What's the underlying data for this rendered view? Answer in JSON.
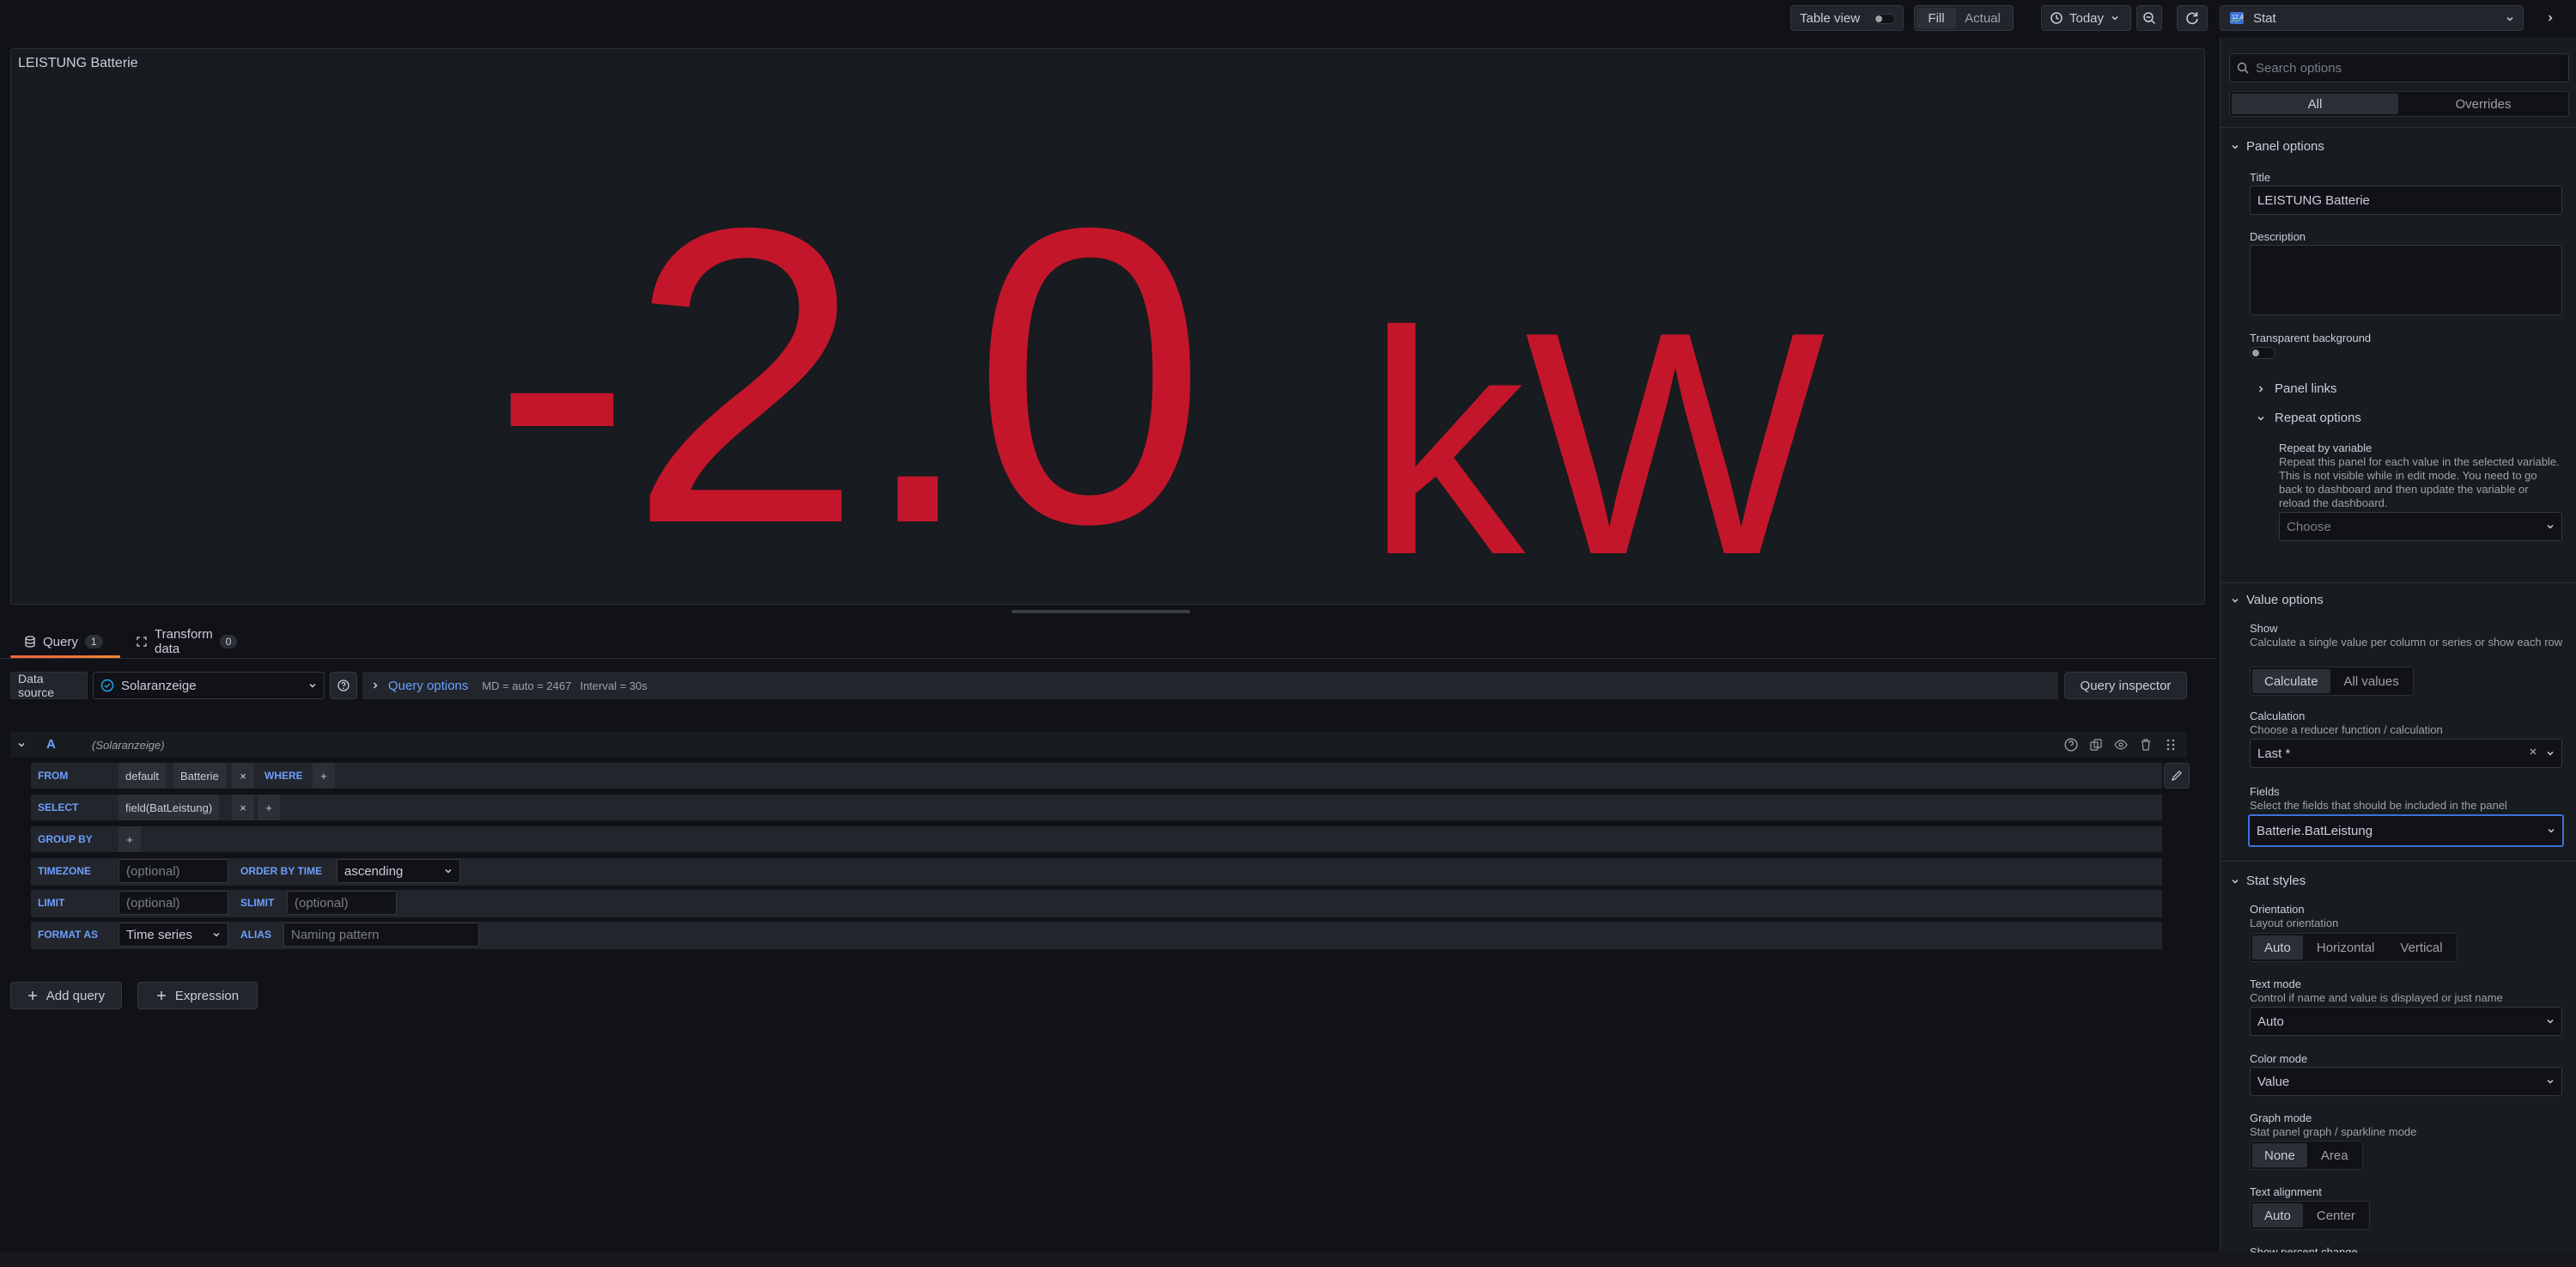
{
  "toolbar": {
    "table_view_label": "Table view",
    "fill_label": "Fill",
    "actual_label": "Actual",
    "time_range": "Today"
  },
  "viz_picker": {
    "label": "Stat"
  },
  "panel": {
    "title": "LEISTUNG Batterie",
    "value": "-2.0",
    "unit": "kW",
    "value_color": "#c4162a"
  },
  "query_tabs": [
    {
      "label": "Query",
      "count": "1"
    },
    {
      "label": "Transform data",
      "count": "0"
    }
  ],
  "datasource": {
    "label": "Data source",
    "value": "Solaranzeige",
    "query_options_label": "Query options",
    "md_info": "MD = auto = 2467",
    "interval_info": "Interval = 30s",
    "inspector_label": "Query inspector"
  },
  "query_a": {
    "ref": "A",
    "source": "(Solaranzeige)",
    "from_kw": "FROM",
    "from_policy": "default",
    "from_measurement": "Batterie",
    "where_kw": "WHERE",
    "select_kw": "SELECT",
    "select_field": "field(BatLeistung)",
    "groupby_kw": "GROUP BY",
    "timezone_kw": "TIMEZONE",
    "timezone_placeholder": "(optional)",
    "orderby_kw": "ORDER BY TIME",
    "orderby_value": "ascending",
    "limit_kw": "LIMIT",
    "limit_placeholder": "(optional)",
    "slimit_kw": "SLIMIT",
    "slimit_placeholder": "(optional)",
    "formatas_kw": "FORMAT AS",
    "formatas_value": "Time series",
    "alias_kw": "ALIAS",
    "alias_placeholder": "Naming pattern",
    "plus": "+",
    "x": "×"
  },
  "add_query_label": "Add query",
  "expression_label": "Expression",
  "options": {
    "search_placeholder": "Search options",
    "tab_all": "All",
    "tab_overrides": "Overrides",
    "panel_options": {
      "header": "Panel options",
      "title_label": "Title",
      "title_value": "LEISTUNG Batterie",
      "description_label": "Description",
      "transparent_label": "Transparent background",
      "panel_links": "Panel links",
      "repeat_options": "Repeat options",
      "repeat_by_label": "Repeat by variable",
      "repeat_desc": "Repeat this panel for each value in the selected variable. This is not visible while in edit mode. You need to go back to dashboard and then update the variable or reload the dashboard.",
      "repeat_choose": "Choose"
    },
    "value_options": {
      "header": "Value options",
      "show_label": "Show",
      "show_desc": "Calculate a single value per column or series or show each row",
      "show_calculate": "Calculate",
      "show_all": "All values",
      "calc_label": "Calculation",
      "calc_desc": "Choose a reducer function / calculation",
      "calc_value": "Last *",
      "fields_label": "Fields",
      "fields_desc": "Select the fields that should be included in the panel",
      "fields_value": "Batterie.BatLeistung"
    },
    "stat_styles": {
      "header": "Stat styles",
      "orientation_label": "Orientation",
      "orientation_desc": "Layout orientation",
      "orientation_opts": [
        "Auto",
        "Horizontal",
        "Vertical"
      ],
      "textmode_label": "Text mode",
      "textmode_desc": "Control if name and value is displayed or just name",
      "textmode_value": "Auto",
      "colormode_label": "Color mode",
      "colormode_value": "Value",
      "graphmode_label": "Graph mode",
      "graphmode_desc": "Stat panel graph / sparkline mode",
      "graphmode_opts": [
        "None",
        "Area"
      ],
      "textalign_label": "Text alignment",
      "textalign_opts": [
        "Auto",
        "Center"
      ],
      "percent_label": "Show percent change"
    }
  }
}
